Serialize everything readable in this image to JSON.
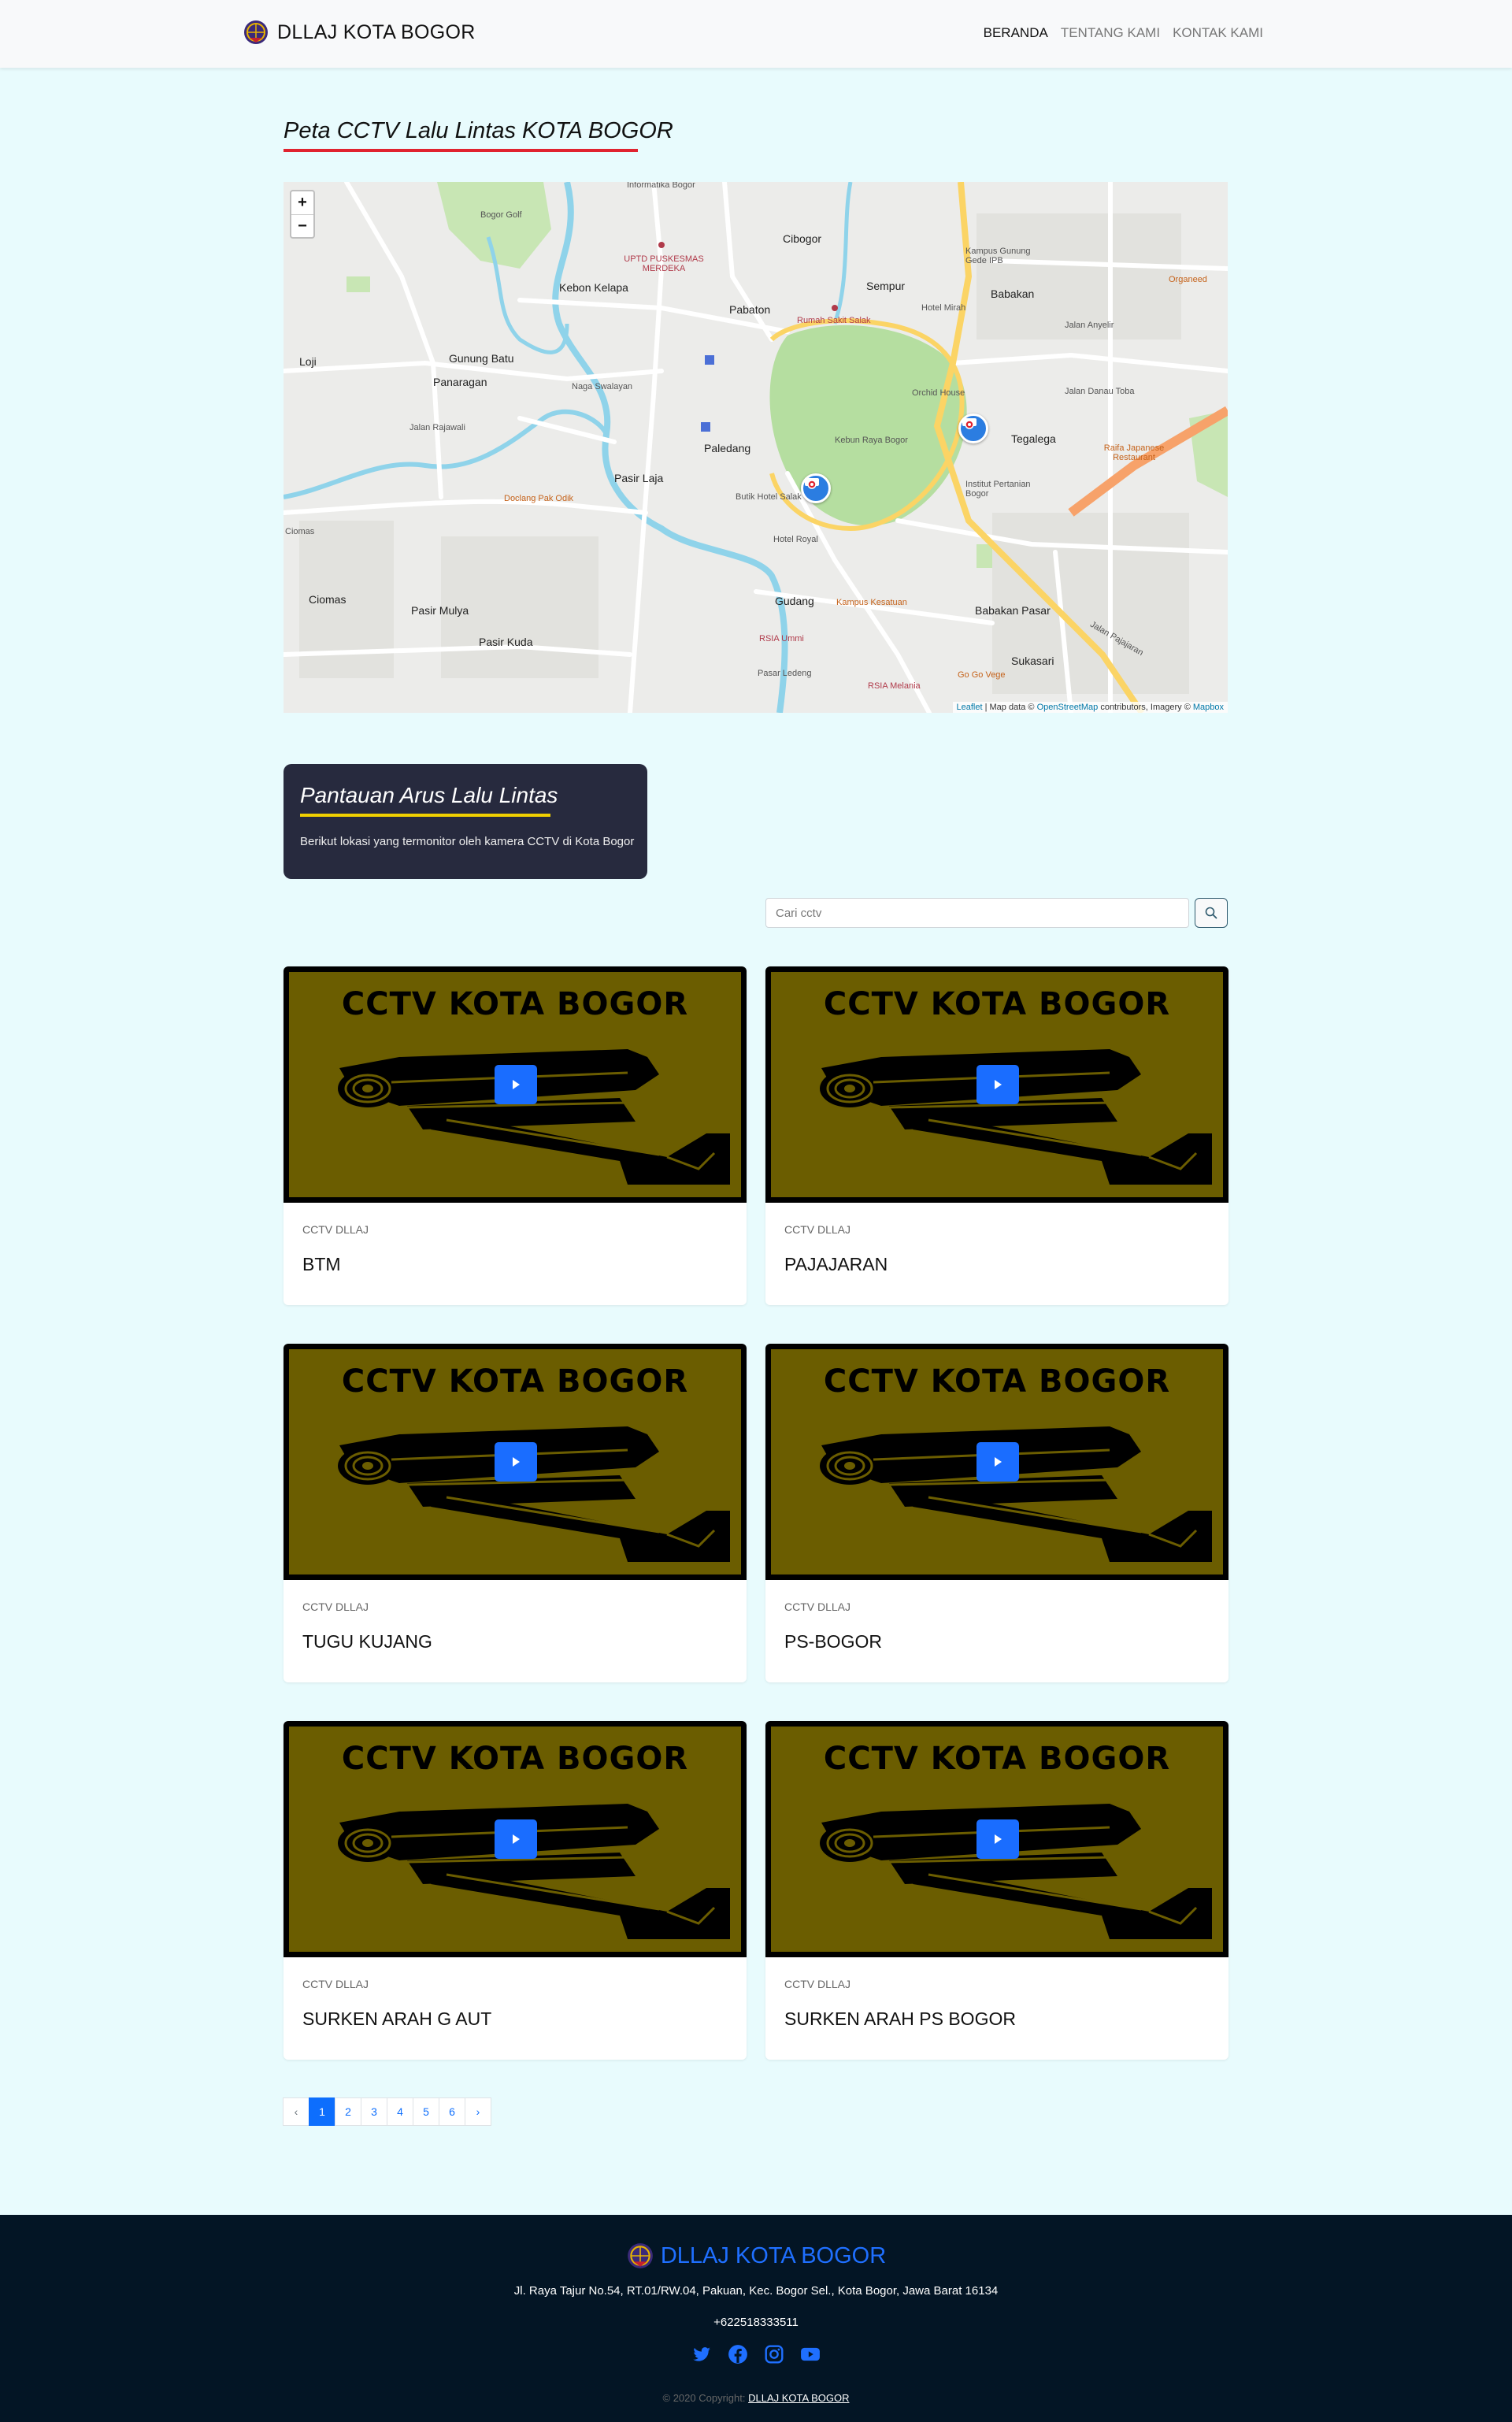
{
  "navbar": {
    "brand": "DLLAJ KOTA BOGOR",
    "links": [
      "BERANDA",
      "TENTANG KAMI",
      "KONTAK KAMI"
    ]
  },
  "map_section": {
    "title": "Peta CCTV Lalu Lintas KOTA BOGOR",
    "zoom_in": "+",
    "zoom_out": "−",
    "attribution": {
      "leaflet": "Leaflet",
      "sep": " | Map data © ",
      "osm": "OpenStreetMap",
      "mid": " contributors, Imagery © ",
      "mapbox": "Mapbox"
    },
    "places": {
      "cibogor": "Cibogor",
      "kebon_kelapa": "Kebon Kelapa",
      "sempur": "Sempur",
      "babakan": "Babakan",
      "pabaton": "Pabaton",
      "loji": "Loji",
      "gunung_batu": "Gunung Batu",
      "panaragan": "Panaragan",
      "paledang": "Paledang",
      "tegalega": "Tegalega",
      "pasir_laja": "Pasir Laja",
      "ciomas": "Ciomas",
      "pasir_mulya": "Pasir Mulya",
      "pasir_kuda": "Pasir Kuda",
      "gudang": "Gudang",
      "babakan_pasar": "Babakan Pasar",
      "sukasari": "Sukasari",
      "kebun_raya": "Kebun Raya Bogor",
      "bogor_golf": "Bogor Golf",
      "uptd": "UPTD PUSKESMAS MERDEKA",
      "rs_salak": "Rumah Sakit Salak",
      "kampus_gunung_gede": "Kampus Gunung Gede IPB",
      "hotel_mirah": "Hotel Mirah",
      "orchid_house": "Orchid House",
      "naga_swalayan": "Naga Swalayan",
      "batik_hotel": "Butik Hotel Salak",
      "hotel_royal": "Hotel Royal",
      "ipb": "Institut Pertanian Bogor",
      "kampus_kesatuan": "Kampus Kesatuan",
      "rsia_ummi": "RSIA Ummi",
      "pasar_ledeng": "Pasar Ledeng",
      "rsia_melania": "RSIA Melania",
      "go_go_vege": "Go Go Vege",
      "raifa": "Raifa Japanese Restaurant",
      "organeed": "Organeed",
      "doclang": "Doclang Pak Odik",
      "c_ciomas": "Ciomas",
      "jalan_anyelir": "Jalan Anyelir",
      "jalan_danau_toba": "Jalan Danau Toba",
      "jalan_rajawali": "Jalan Rajawali",
      "jalan_padjajaran": "Jalan Pajajaran",
      "informatika": "Informatika Bogor"
    }
  },
  "info_card": {
    "title": "Pantauan Arus Lalu Lintas",
    "description": "Berikut lokasi yang termonitor oleh kamera CCTV di Kota Bogor"
  },
  "search": {
    "placeholder": "Cari cctv"
  },
  "cctv_cards": [
    {
      "thumb_text": "CCTV KOTA BOGOR",
      "category": "CCTV DLLAJ",
      "name": "BTM"
    },
    {
      "thumb_text": "CCTV KOTA BOGOR",
      "category": "CCTV DLLAJ",
      "name": "PAJAJARAN"
    },
    {
      "thumb_text": "CCTV KOTA BOGOR",
      "category": "CCTV DLLAJ",
      "name": "TUGU KUJANG"
    },
    {
      "thumb_text": "CCTV KOTA BOGOR",
      "category": "CCTV DLLAJ",
      "name": "PS-BOGOR"
    },
    {
      "thumb_text": "CCTV KOTA BOGOR",
      "category": "CCTV DLLAJ",
      "name": "SURKEN ARAH G AUT"
    },
    {
      "thumb_text": "CCTV KOTA BOGOR",
      "category": "CCTV DLLAJ",
      "name": "SURKEN ARAH PS BOGOR"
    }
  ],
  "pagination": {
    "prev": "‹",
    "pages": [
      "1",
      "2",
      "3",
      "4",
      "5",
      "6"
    ],
    "next": "›",
    "current": "1"
  },
  "footer": {
    "brand": "DLLAJ KOTA BOGOR",
    "address": "Jl. Raya Tajur No.54, RT.01/RW.04, Pakuan, Kec. Bogor Sel., Kota Bogor, Jawa Barat 16134",
    "phone": "+622518333511",
    "copyright_prefix": "© 2020 Copyright: ",
    "copyright_link": "DLLAJ KOTA BOGOR",
    "social_icons": [
      "twitter-icon",
      "facebook-icon",
      "instagram-icon",
      "youtube-icon"
    ]
  },
  "colors": {
    "page_bg": "#e8fbfd",
    "title_underline": "#e0232f",
    "info_card_bg": "#272a3e",
    "info_underline": "#f0d000",
    "thumb_bg": "#6b5d00",
    "primary": "#0d6efd",
    "footer_bg": "#031525"
  }
}
